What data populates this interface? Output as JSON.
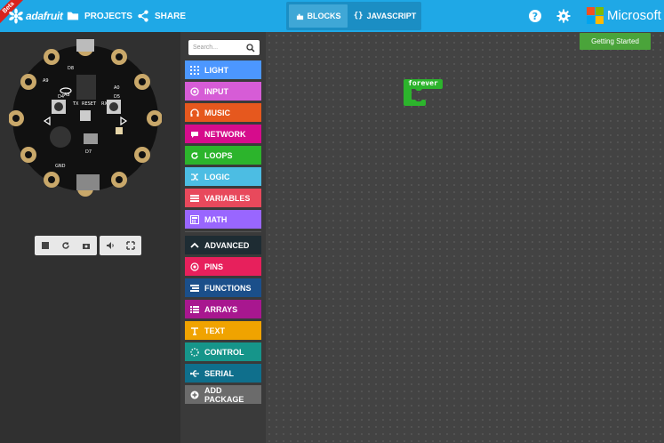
{
  "topbar": {
    "beta": "Beta",
    "brand": "adafruit",
    "projects": "PROJECTS",
    "share": "SHARE",
    "blocks": "BLOCKS",
    "javascript": "JAVASCRIPT",
    "microsoft": "Microsoft"
  },
  "board": {
    "labels": {
      "d8": "D8",
      "a0": "A0",
      "a9": "A9",
      "a8": "A8",
      "d4": "D4",
      "tx": "TX",
      "reset": "RESET",
      "rx": "RX",
      "d5": "D5",
      "d7": "D7",
      "gnd": "GND"
    }
  },
  "sim_controls": [
    "stop-icon",
    "restart-icon",
    "screenshot-icon",
    "mute-icon",
    "fullscreen-icon"
  ],
  "toolbox": {
    "search_placeholder": "Search...",
    "categories": [
      {
        "label": "LIGHT",
        "color": "#4c97ff",
        "icon": "light-icon"
      },
      {
        "label": "INPUT",
        "color": "#d65cd6",
        "icon": "input-icon"
      },
      {
        "label": "MUSIC",
        "color": "#e6581e",
        "icon": "music-icon"
      },
      {
        "label": "NETWORK",
        "color": "#d60c8c",
        "icon": "network-icon"
      },
      {
        "label": "LOOPS",
        "color": "#2cb42c",
        "icon": "loops-icon"
      },
      {
        "label": "LOGIC",
        "color": "#4cbde3",
        "icon": "logic-icon"
      },
      {
        "label": "VARIABLES",
        "color": "#e8495c",
        "icon": "variables-icon"
      },
      {
        "label": "MATH",
        "color": "#9966ff",
        "icon": "math-icon"
      },
      {
        "label": "ADVANCED",
        "color": "#1e2c33",
        "icon": "advanced-icon"
      },
      {
        "label": "PINS",
        "color": "#e7205c",
        "icon": "pins-icon"
      },
      {
        "label": "FUNCTIONS",
        "color": "#1b4f8a",
        "icon": "functions-icon"
      },
      {
        "label": "ARRAYS",
        "color": "#a8178f",
        "icon": "arrays-icon"
      },
      {
        "label": "TEXT",
        "color": "#f0a300",
        "icon": "text-icon"
      },
      {
        "label": "CONTROL",
        "color": "#16958a",
        "icon": "control-icon"
      },
      {
        "label": "SERIAL",
        "color": "#0f6f8c",
        "icon": "serial-icon"
      },
      {
        "label": "ADD PACKAGE",
        "color": "#6b6b6b",
        "icon": "add-package-icon"
      }
    ]
  },
  "workspace": {
    "getting_started": "Getting Started",
    "block_label": "forever"
  },
  "colors": {
    "topbar": "#1fa8e6",
    "block_green": "#2cb42c",
    "workspace": "#434343"
  }
}
